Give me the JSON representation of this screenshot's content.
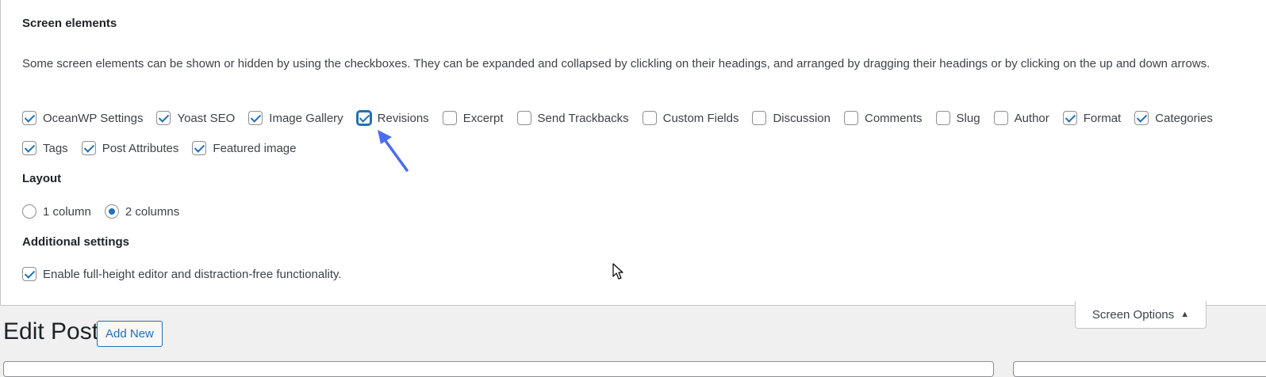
{
  "screen_options": {
    "elements_heading": "Screen elements",
    "description": "Some screen elements can be shown or hidden by using the checkboxes. They can be expanded and collapsed by clickling on their headings, and arranged by dragging their headings or by clicking on the up and down arrows.",
    "checkboxes_row1": [
      {
        "label": "OceanWP Settings",
        "checked": true
      },
      {
        "label": "Yoast SEO",
        "checked": true
      },
      {
        "label": "Image Gallery",
        "checked": true
      },
      {
        "label": "Revisions",
        "checked": true,
        "focused": true
      },
      {
        "label": "Excerpt",
        "checked": false
      },
      {
        "label": "Send Trackbacks",
        "checked": false
      },
      {
        "label": "Custom Fields",
        "checked": false
      },
      {
        "label": "Discussion",
        "checked": false
      },
      {
        "label": "Comments",
        "checked": false
      },
      {
        "label": "Slug",
        "checked": false
      },
      {
        "label": "Author",
        "checked": false
      },
      {
        "label": "Format",
        "checked": true
      },
      {
        "label": "Categories",
        "checked": true
      }
    ],
    "checkboxes_row2": [
      {
        "label": "Tags",
        "checked": true
      },
      {
        "label": "Post Attributes",
        "checked": true
      },
      {
        "label": "Featured image",
        "checked": true
      }
    ],
    "layout_heading": "Layout",
    "layout_options": [
      {
        "label": "1 column",
        "checked": false
      },
      {
        "label": "2 columns",
        "checked": true
      }
    ],
    "additional_heading": "Additional settings",
    "additional_option": {
      "label": "Enable full-height editor and distraction-free functionality.",
      "checked": true
    }
  },
  "screen_options_tab": {
    "label": "Screen Options",
    "arrow": "▲"
  },
  "page": {
    "title": "Edit Post",
    "add_new_label": "Add New"
  },
  "colors": {
    "accent": "#2271b1",
    "annotation_arrow": "#4a6cf0"
  }
}
